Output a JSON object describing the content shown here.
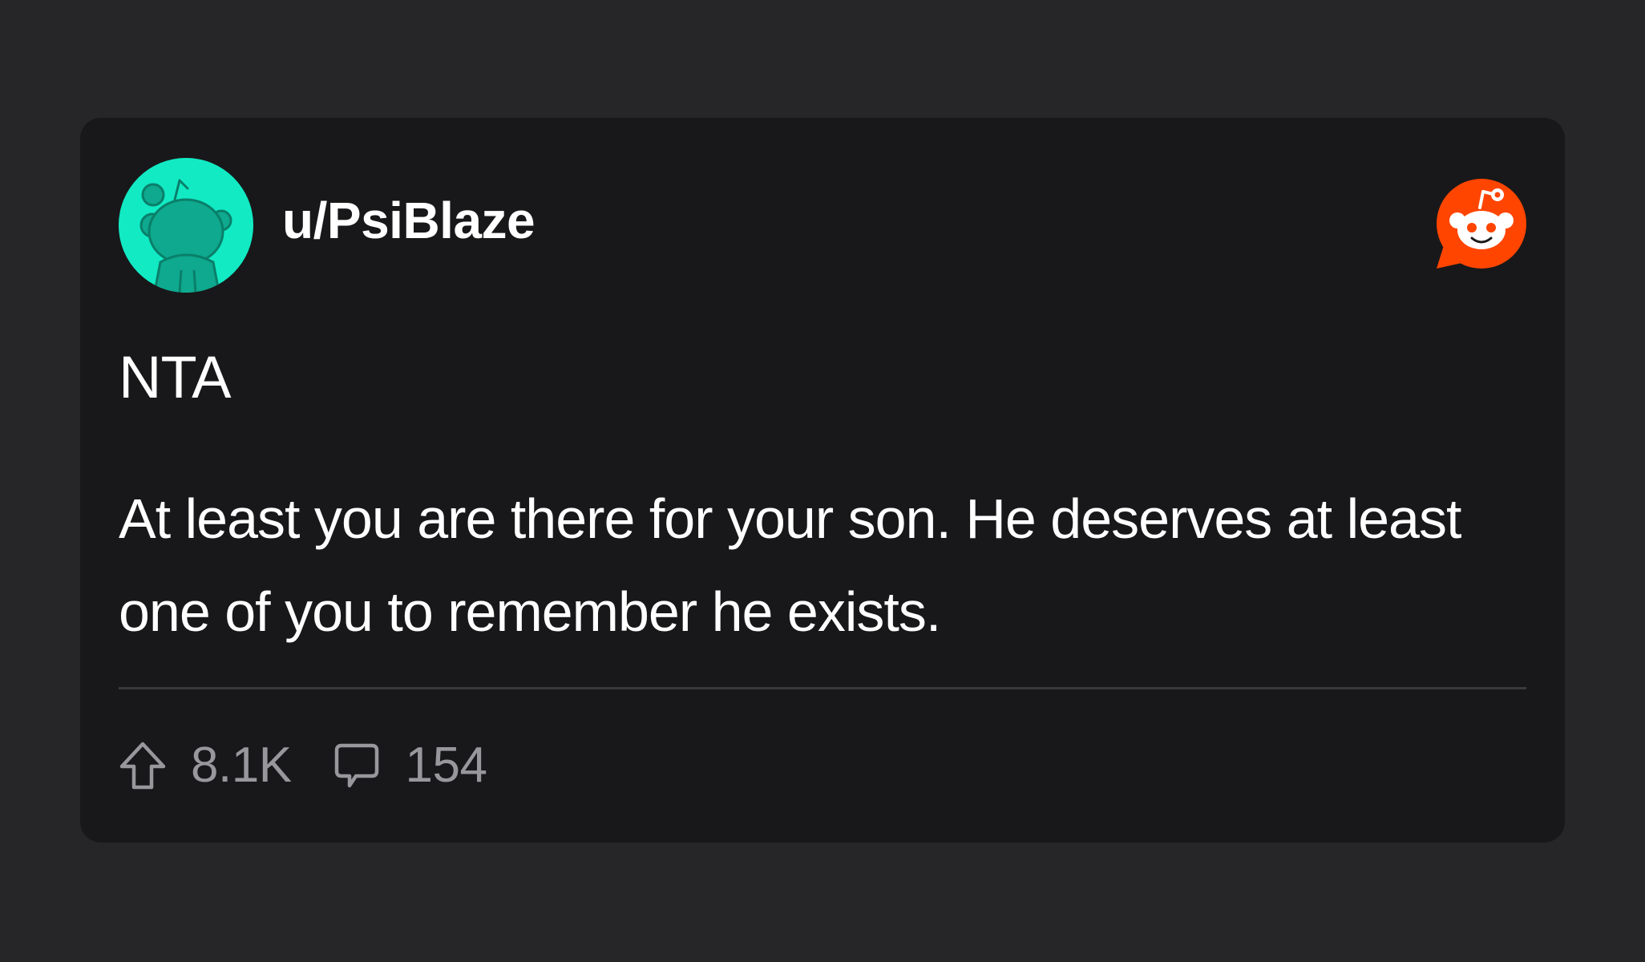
{
  "post": {
    "username": "u/PsiBlaze",
    "verdict": "NTA",
    "body": "At least you are there for your son. He deserves at least one of you to remember he exists."
  },
  "actions": {
    "upvotes": "8.1K",
    "comments": "154"
  },
  "icons": {
    "avatar": "snoo-avatar-icon",
    "brand": "reddit-logo-icon",
    "upvote": "upvote-arrow-icon",
    "comment": "comment-bubble-icon"
  },
  "colors": {
    "background": "#262628",
    "card": "#18181a",
    "avatar_bg": "#12eac4",
    "reddit_orange": "#ff4500",
    "text": "#ffffff",
    "muted": "#98989c"
  }
}
